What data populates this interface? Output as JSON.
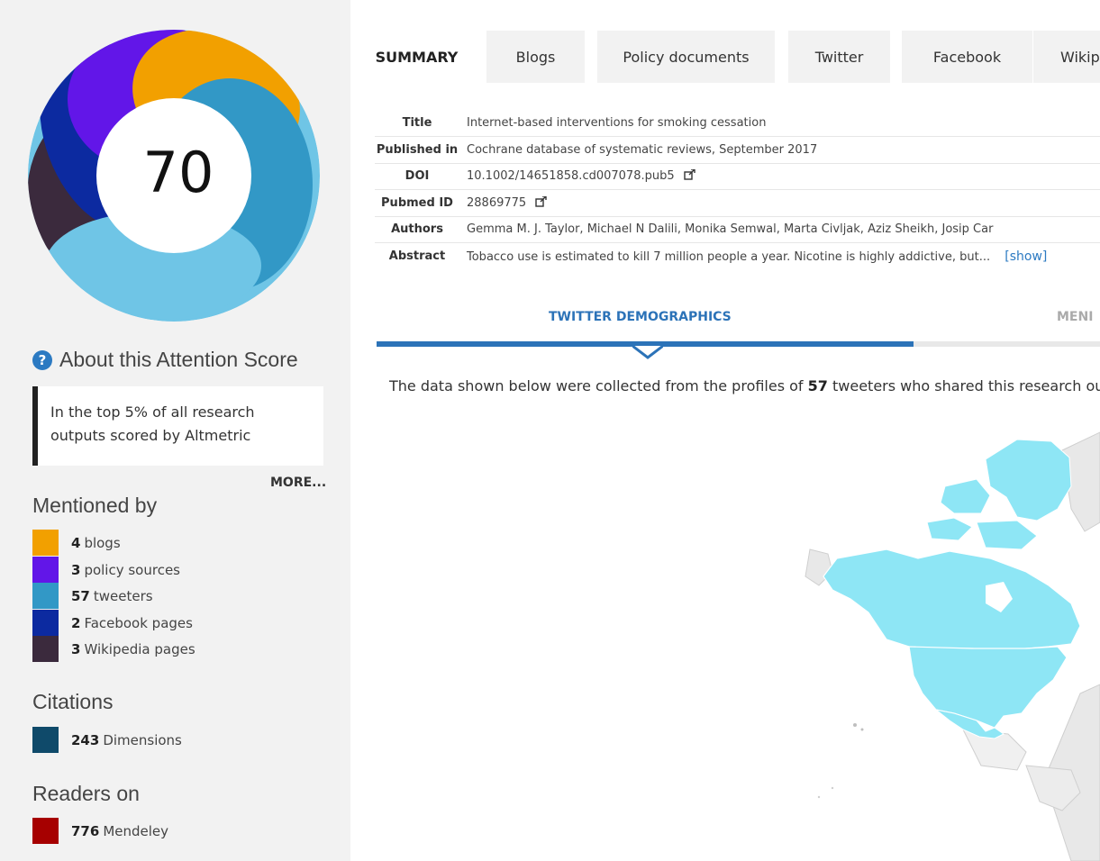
{
  "score": {
    "value": "70",
    "about_label": "About this Attention Score",
    "callout": "In the top 5% of all research outputs scored by Altmetric",
    "more": "MORE..."
  },
  "mentioned_by": {
    "heading": "Mentioned by",
    "items": [
      {
        "count": "4",
        "label": "blogs",
        "color": "#f2a000"
      },
      {
        "count": "3",
        "label": "policy sources",
        "color": "#6216e8"
      },
      {
        "count": "57",
        "label": "tweeters",
        "color": "#3298c6"
      },
      {
        "count": "2",
        "label": "Facebook pages",
        "color": "#0c2aa0"
      },
      {
        "count": "3",
        "label": "Wikipedia pages",
        "color": "#3b2a3d"
      }
    ]
  },
  "citations": {
    "heading": "Citations",
    "items": [
      {
        "count": "243",
        "label": "Dimensions",
        "color": "#0f4a6a"
      }
    ]
  },
  "readers": {
    "heading": "Readers on",
    "items": [
      {
        "count": "776",
        "label": "Mendeley",
        "color": "#a60000"
      }
    ]
  },
  "tabs": [
    {
      "label": "SUMMARY",
      "active": true
    },
    {
      "label": "Blogs"
    },
    {
      "label": "Policy documents"
    },
    {
      "label": "Twitter"
    },
    {
      "label": "Facebook"
    },
    {
      "label": "Wikip"
    }
  ],
  "meta": {
    "title_key": "Title",
    "title": "Internet-based interventions for smoking cessation",
    "published_key": "Published in",
    "published": "Cochrane database of systematic reviews, September 2017",
    "doi_key": "DOI",
    "doi": "10.1002/14651858.cd007078.pub5",
    "pubmed_key": "Pubmed ID",
    "pubmed": "28869775",
    "authors_key": "Authors",
    "authors": "Gemma M. J. Taylor, Michael N Dalili, Monika Semwal, Marta Civljak, Aziz Sheikh, Josip Car",
    "abstract_key": "Abstract",
    "abstract": "Tobacco use is estimated to kill 7 million people a year. Nicotine is highly addictive, but...",
    "show": "[show]"
  },
  "subtabs": {
    "active": "TWITTER DEMOGRAPHICS",
    "next": "MENI"
  },
  "intro": {
    "before": "The data shown below were collected from the profiles of ",
    "count": "57",
    "after": " tweeters who shared this research ou"
  },
  "colors": {
    "accent": "#2c73b8",
    "map_fill": "#8ee6f5",
    "map_other": "#e8e8e8"
  }
}
